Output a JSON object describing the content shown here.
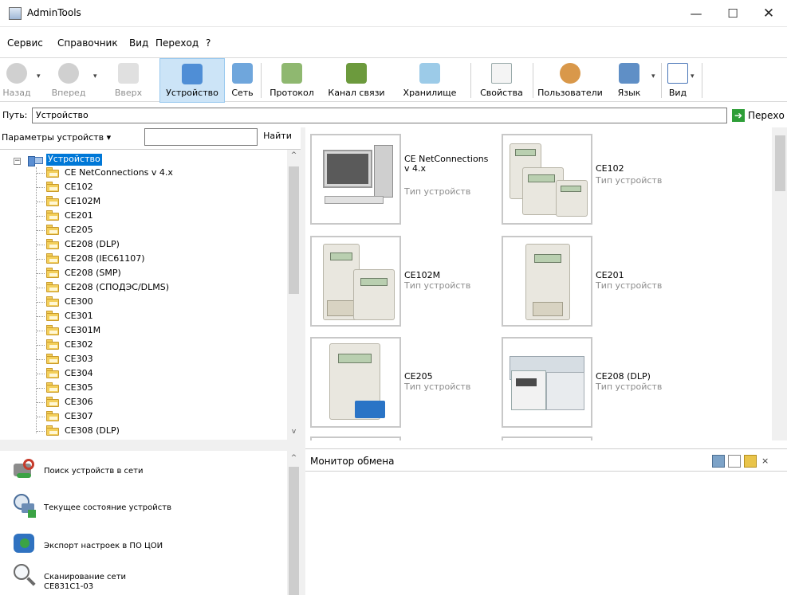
{
  "window": {
    "title": "AdminTools",
    "minimize_glyph": "—",
    "maximize_glyph": "☐",
    "close_glyph": "✕"
  },
  "menu": [
    "Сервис",
    "Справочник",
    "Вид",
    "Переход",
    "?"
  ],
  "toolbar": {
    "back": "Назад",
    "forward": "Вперед",
    "up": "Вверх",
    "device": "Устройство",
    "network": "Сеть",
    "protocol": "Протокол",
    "channel": "Канал связи",
    "storage": "Хранилище",
    "properties": "Свойства",
    "users": "Пользователи",
    "language": "Язык",
    "view": "Вид"
  },
  "path": {
    "label": "Путь:",
    "value": "Устройство",
    "go_label": "Перехо"
  },
  "search": {
    "params_label": "Параметры устройств ▾",
    "find_label": "Найти"
  },
  "tree": {
    "root": "Устройство",
    "items": [
      "CE NetConnections v 4.x",
      "CE102",
      "CE102M",
      "CE201",
      "CE205",
      "CE208 (DLP)",
      "CE208 (IEC61107)",
      "CE208 (SMP)",
      "CE208 (СПОДЭС/DLMS)",
      "CE300",
      "CE301",
      "CE301M",
      "CE302",
      "CE303",
      "CE304",
      "CE305",
      "CE306",
      "CE307",
      "CE308 (DLP)"
    ]
  },
  "devices": [
    {
      "name": "CE NetConnections v 4.x",
      "type": "Тип устройств"
    },
    {
      "name": "CE102",
      "type": "Тип устройств"
    },
    {
      "name": "CE102M",
      "type": "Тип устройств"
    },
    {
      "name": "CE201",
      "type": "Тип устройств"
    },
    {
      "name": "CE205",
      "type": "Тип устройств"
    },
    {
      "name": "CE208 (DLP)",
      "type": "Тип устройств"
    }
  ],
  "tasks": [
    "Поиск устройств в сети",
    "Текущее состояние устройств",
    "Экспорт настроек в ПО ЦОИ",
    "Сканирование сети"
  ],
  "task_sub": "CE831C1-03",
  "monitor": {
    "title": "Монитор обмена"
  },
  "colors": {
    "selection": "#0078d7",
    "toolbar_active": "#cce4f7",
    "folder": "#f3cf5a"
  }
}
